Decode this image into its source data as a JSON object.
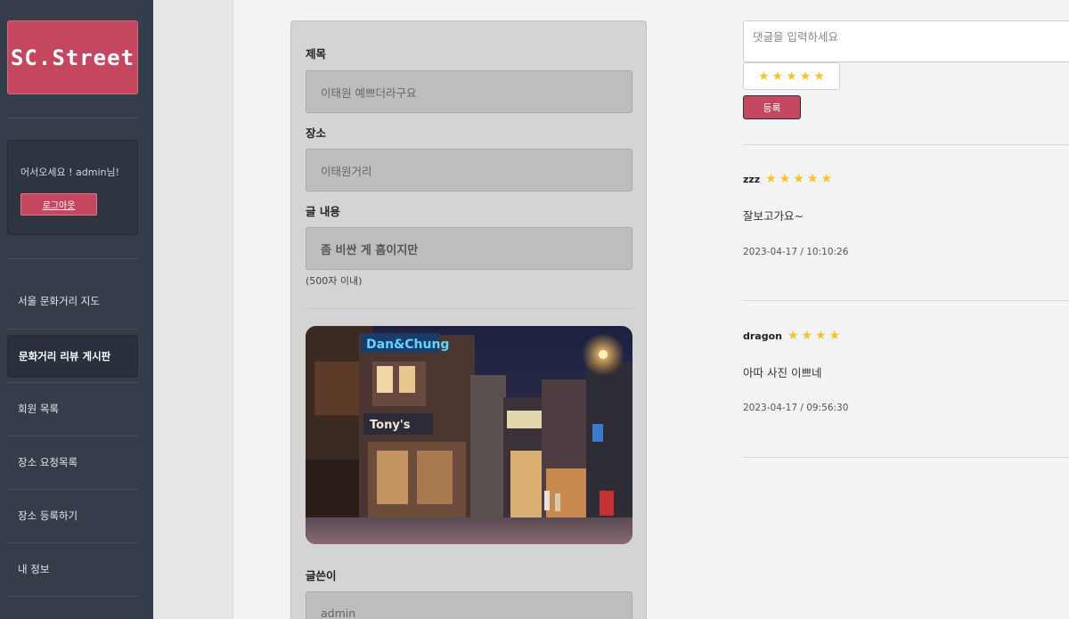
{
  "sidebar": {
    "logo": "SC.Street",
    "welcome": "어서오세요 ! admin님!",
    "logout_label": "로그아웃",
    "nav": [
      {
        "label": "서울 문화거리 지도"
      },
      {
        "label": "문화거리 리뷰 게시판"
      },
      {
        "label": "회원 목록"
      },
      {
        "label": "장소 요청목록"
      },
      {
        "label": "장소 등록하기"
      },
      {
        "label": "내 정보"
      }
    ]
  },
  "form": {
    "title_label": "제목",
    "title_value": "이태원 예쁘더라구요",
    "place_label": "장소",
    "place_value": "이태원거리",
    "content_label": "글 내용",
    "content_value": "좀 비싼 게 흠이지만",
    "content_hint": "(500자 이내)",
    "author_label": "글쓴이",
    "author_value": "admin"
  },
  "comment_form": {
    "placeholder": "댓글을 입력하세요",
    "rating": 5,
    "submit_label": "등록"
  },
  "comments": [
    {
      "author": "zzz",
      "rating": 5,
      "text": "잘보고가요~",
      "date": "2023-04-17 / 10:10:26"
    },
    {
      "author": "dragon",
      "rating": 4,
      "text": "아따 사진 이쁘네",
      "date": "2023-04-17 / 09:56:30"
    }
  ],
  "colors": {
    "accent": "#c5475f",
    "sidebar": "#353d4a",
    "star": "#f3c327"
  }
}
